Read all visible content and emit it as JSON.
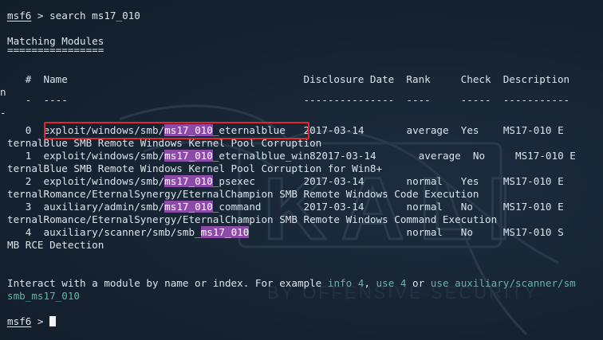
{
  "prompt": {
    "name": "msf6",
    "symbol": " > ",
    "command": "search ms17_010"
  },
  "heading": {
    "title": "Matching Modules",
    "rule": "================"
  },
  "table": {
    "header_line": "   #  Name                                       Disclosure Date  Rank     Check  Description",
    "header_wrap": "n",
    "rule_line": "   -  ----                                       ---------------  ----     -----  -----------",
    "rule_wrap": "-",
    "highlight": "ms17_010",
    "rows": [
      {
        "index": "0",
        "name_prefix": "exploit/windows/smb/",
        "name_match": "ms17_010",
        "name_suffix": "_eternalblue",
        "disclosure": "2017-03-14",
        "rank": "average",
        "check": "Yes",
        "desc_start": "MS17-010 E",
        "desc_wrap": "ternalBlue SMB Remote Windows Kernel Pool Corruption"
      },
      {
        "index": "1",
        "name_prefix": "exploit/windows/smb/",
        "name_match": "ms17_010",
        "name_suffix": "_eternalblue_win8",
        "disclosure": "2017-03-14",
        "rank": "average",
        "check": "No",
        "desc_start": "MS17-010 E",
        "desc_wrap": "ternalBlue SMB Remote Windows Kernel Pool Corruption for Win8+"
      },
      {
        "index": "2",
        "name_prefix": "exploit/windows/smb/",
        "name_match": "ms17_010",
        "name_suffix": "_psexec",
        "disclosure": "2017-03-14",
        "rank": "normal",
        "check": "Yes",
        "desc_start": "MS17-010 E",
        "desc_wrap": "ternalRomance/EternalSynergy/EternalChampion SMB Remote Windows Code Execution"
      },
      {
        "index": "3",
        "name_prefix": "auxiliary/admin/smb/",
        "name_match": "ms17_010",
        "name_suffix": "_command",
        "disclosure": "2017-03-14",
        "rank": "normal",
        "check": "No",
        "desc_start": "MS17-010 E",
        "desc_wrap": "ternalRomance/EternalSynergy/EternalChampion SMB Remote Windows Command Execution"
      },
      {
        "index": "4",
        "name_prefix": "auxiliary/scanner/smb/smb_",
        "name_match": "ms17_010",
        "name_suffix": "",
        "disclosure": "",
        "rank": "normal",
        "check": "No",
        "desc_start": "MS17-010 S",
        "desc_wrap": "MB RCE Detection"
      }
    ]
  },
  "footer": {
    "pre": "Interact with a module by name or index. For example ",
    "info_cmd": "info 4",
    "comma": ", ",
    "use_cmd": "use 4",
    "or": " or ",
    "use_path_cmd": "use auxiliary/scanner/sm",
    "wrap": "smb_ms17_010"
  },
  "prompt2": {
    "name": "msf6",
    "symbol": " > "
  },
  "colors": {
    "background": "#152231",
    "text": "#dde3ea",
    "highlight": "#8e4aa8",
    "hint": "#5fb6a8",
    "annotation_box": "#e0272b"
  },
  "watermark": {
    "logo_text": "KALI",
    "tagline": "BY OFFENSIVE SECURITY"
  }
}
